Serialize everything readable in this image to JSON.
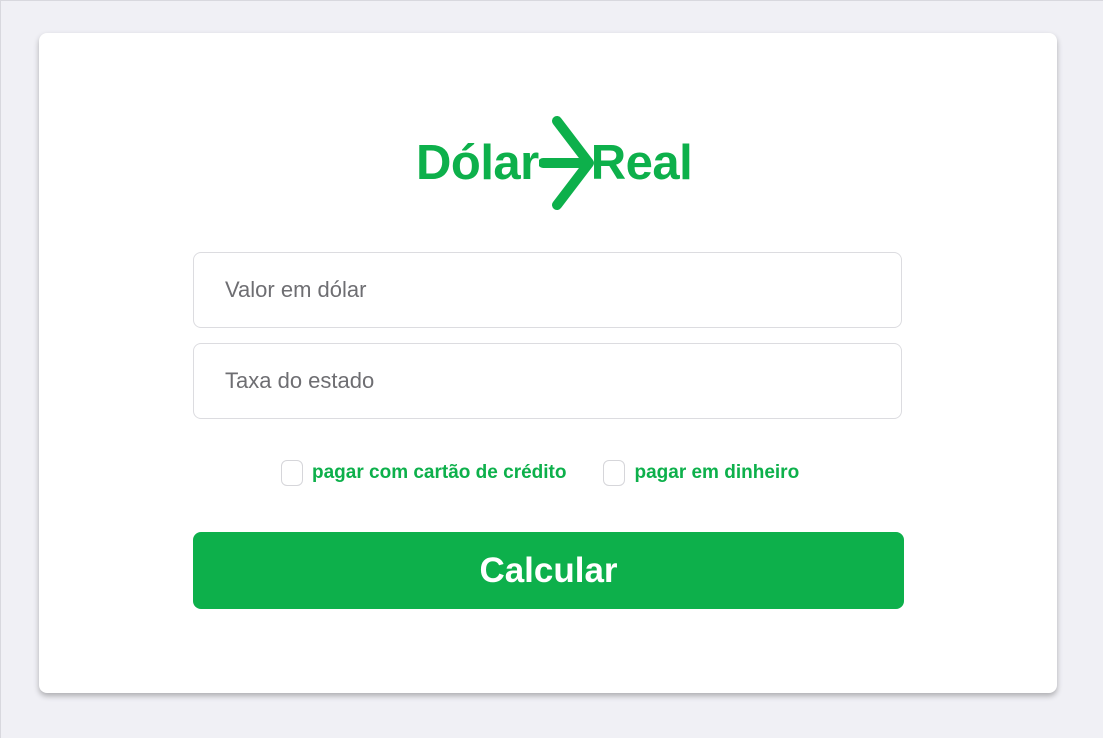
{
  "logo": {
    "left_word": "Dólar",
    "right_word": "Real",
    "icon": "arrow-right-icon",
    "color": "#0db04b"
  },
  "form": {
    "dollar_placeholder": "Valor em dólar",
    "dollar_value": "",
    "tax_placeholder": "Taxa do estado",
    "tax_value": "",
    "options": [
      {
        "label": "pagar com cartão de crédito",
        "checked": false
      },
      {
        "label": "pagar em dinheiro",
        "checked": false
      }
    ],
    "submit_label": "Calcular"
  },
  "colors": {
    "accent": "#0db04b",
    "background": "#f0f0f5",
    "card": "#ffffff"
  }
}
